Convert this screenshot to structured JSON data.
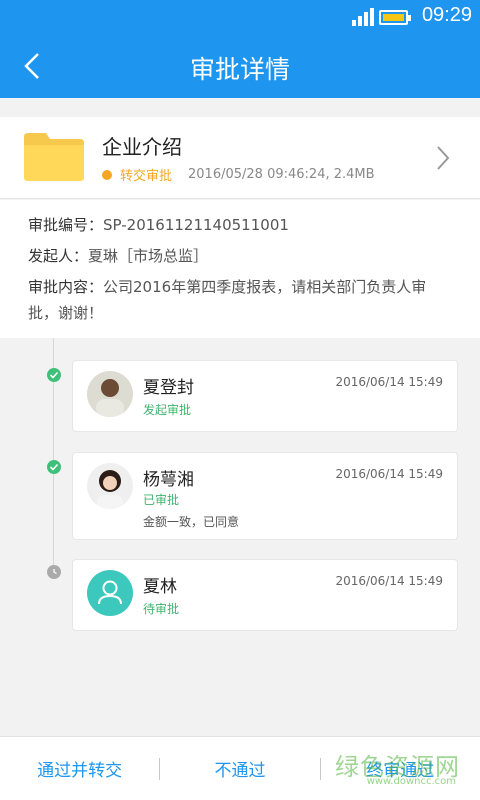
{
  "status_bar": {
    "time": "09:29"
  },
  "header": {
    "title": "审批详情"
  },
  "file": {
    "name": "企业介绍",
    "status": "转交审批",
    "datetime": "2016/05/28  09:46:24, 2.4MB",
    "status_color": "#f5a623"
  },
  "info": {
    "number_label": "审批编号：",
    "number_value": "SP-20161121140511001",
    "initiator_label": "发起人：",
    "initiator_value": "夏琳［市场总监］",
    "content_label": "审批内容：",
    "content_value": "公司2016年第四季度报表，请相关部门负责人审批，谢谢！"
  },
  "steps": [
    {
      "name": "夏登封",
      "time": "2016/06/14  15:49",
      "state": "发起审批",
      "comment": ""
    },
    {
      "name": "杨萼湘",
      "time": "2016/06/14  15:49",
      "state": "已审批",
      "comment": "金额一致，已同意"
    },
    {
      "name": "夏林",
      "time": "2016/06/14  15:49",
      "state": "待审批",
      "comment": ""
    }
  ],
  "actions": {
    "approve_forward": "通过并转交",
    "reject": "不通过",
    "final_approve": "终审通过"
  },
  "watermark": {
    "text": "绿色资源网",
    "url": "www.downcc.com"
  },
  "colors": {
    "primary": "#1e96f0",
    "success": "#3fb46e",
    "warning": "#f5a623",
    "folder": "#ffd54f"
  },
  "icons": [
    "back-arrow-icon",
    "folder-icon",
    "chevron-right-icon",
    "check-icon",
    "clock-icon",
    "user-icon",
    "signal-icon",
    "battery-icon"
  ]
}
